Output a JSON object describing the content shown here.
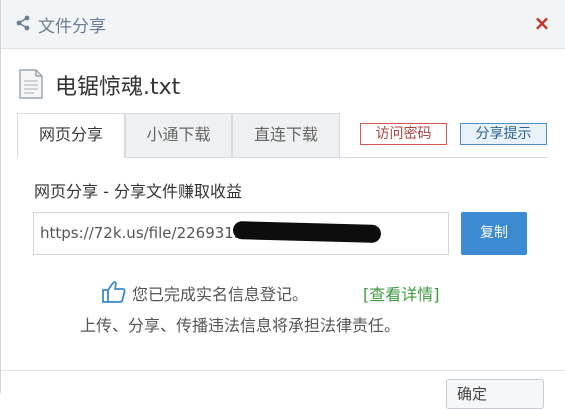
{
  "dialog": {
    "title": "文件分享",
    "close_symbol": "×",
    "file_name": "电锯惊魂.txt"
  },
  "tabs": [
    {
      "label": "网页分享"
    },
    {
      "label": "小通下载"
    },
    {
      "label": "直连下载"
    }
  ],
  "actions": {
    "password_label": "访问密码",
    "tip_label": "分享提示"
  },
  "share": {
    "section_title": "网页分享 - 分享文件赚取收益",
    "url_value": "https://72k.us/file/22693155-4",
    "copy_label": "复制"
  },
  "notice": {
    "verified_text": "您已完成实名信息登记。",
    "details_link": "[查看详情]",
    "legal_text": "上传、分享、传播违法信息将承担法律责任。"
  },
  "footer": {
    "ok_label": "确定"
  },
  "icons": {
    "title": "share-icon",
    "file": "document-icon",
    "notice": "thumbs-up-icon"
  },
  "colors": {
    "primary_button": "#3c8ad1",
    "close": "#c9302c",
    "link_green": "#3c9a3c",
    "password_border": "#d9534f",
    "tip_border": "#4a90c2"
  }
}
